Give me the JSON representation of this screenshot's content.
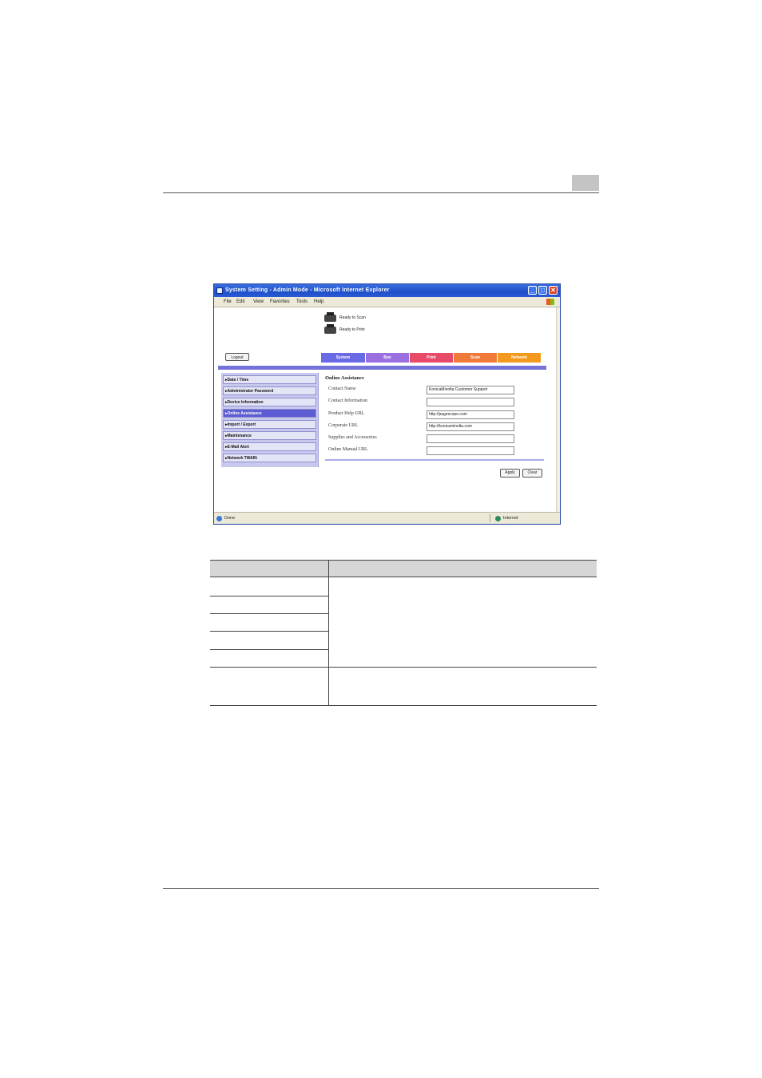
{
  "page": {
    "header_box_color": "#c4c4c4"
  },
  "browser": {
    "title": "System Setting - Admin Mode - Microsoft Internet Explorer",
    "menu": [
      "File",
      "Edit",
      "View",
      "Favorites",
      "Tools",
      "Help"
    ],
    "window_buttons": {
      "minimize": "_",
      "maximize": "□",
      "close": "✕"
    },
    "status": {
      "left": "Done",
      "right": "Internet"
    }
  },
  "device_status": [
    {
      "icon": "scanner-icon",
      "text": "Ready to Scan"
    },
    {
      "icon": "printer-icon",
      "text": "Ready to Print"
    }
  ],
  "logout_label": "Logout",
  "tabs": [
    {
      "label": "System",
      "color": "#6a6ae6"
    },
    {
      "label": "Box",
      "color": "#9b6fe0"
    },
    {
      "label": "Print",
      "color": "#e84a6a"
    },
    {
      "label": "Scan",
      "color": "#f07a3a"
    },
    {
      "label": "Network",
      "color": "#f39a1e"
    }
  ],
  "sidebar": [
    {
      "label": "Date / Time",
      "active": false
    },
    {
      "label": "Administrator Password",
      "active": false
    },
    {
      "label": "Device Information",
      "active": false
    },
    {
      "label": "Online Assistance",
      "active": true
    },
    {
      "label": "Import / Export",
      "active": false
    },
    {
      "label": "Maintenance",
      "active": false
    },
    {
      "label": "E-Mail Alert",
      "active": false
    },
    {
      "label": "Network TWAIN",
      "active": false
    }
  ],
  "form": {
    "title": "Online Assistance",
    "fields": [
      {
        "label": "Contact Name",
        "value": "KonicaMinolta Customer Support"
      },
      {
        "label": "Contact Information",
        "value": ""
      },
      {
        "label": "Product Help URL",
        "value": "http://pagescope.com"
      },
      {
        "label": "Corporate URL",
        "value": "http://konicaminolta.com"
      },
      {
        "label": "Supplies and Accessories",
        "value": ""
      },
      {
        "label": "Online Manual URL",
        "value": ""
      }
    ],
    "apply_label": "Apply",
    "clear_label": "Clear"
  }
}
